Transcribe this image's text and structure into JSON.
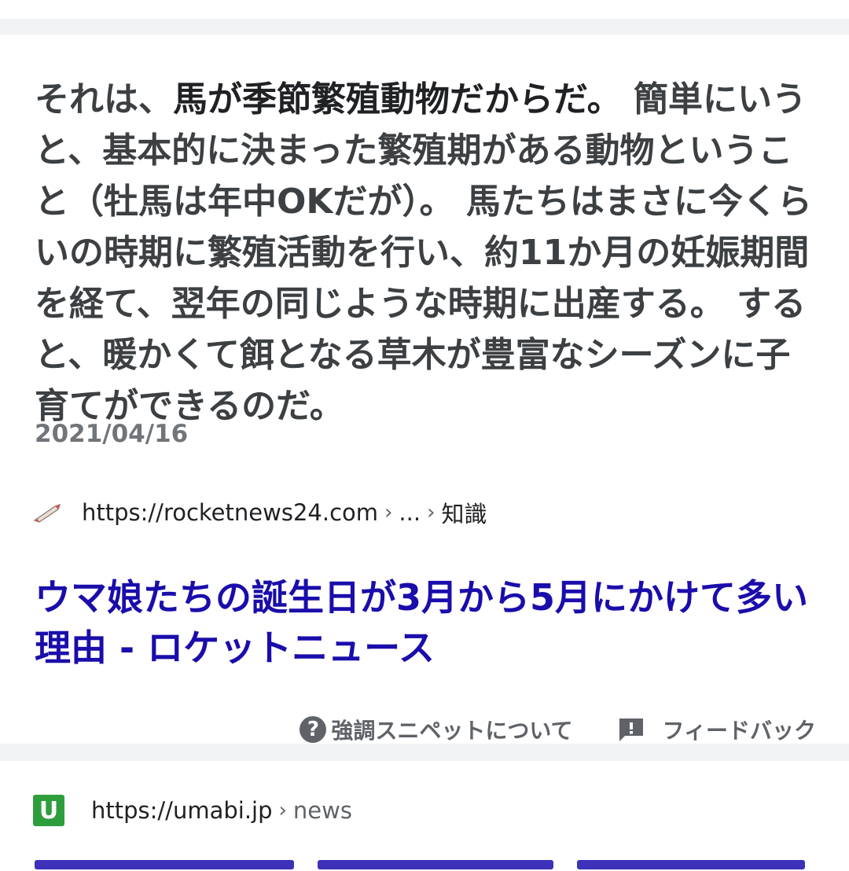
{
  "featured_snippet": {
    "text_intro": "それは、",
    "text_emphasis": "馬が季節繁殖動物だからだ。",
    "text_body": " 簡単にいうと、基本的に決まった繁殖期がある動物ということ（牡馬は年中OKだが）。 馬たちはまさに今くらいの時期に繁殖活動を行い、約11か月の妊娠期間を経て、翌年の同じような時期に出産する。 すると、暖かくて餌となる草木が豊富なシーズンに子育てができるのだ。",
    "date": "2021/04/16",
    "source": {
      "favicon": "rocket-icon",
      "url": "https://rocketnews24.com",
      "crumb_ellipsis": "...",
      "crumb_last": "知識",
      "separator": "›"
    },
    "title": "ウマ娘たちの誕生日が3月から5月にかけて多い理由 - ロケットニュース",
    "actions": {
      "about_label": "強調スニペットについて",
      "feedback_label": "フィードバック"
    }
  },
  "next_result": {
    "favicon_letter": "U",
    "url": "https://umabi.jp",
    "separator": "›",
    "crumb": "news"
  },
  "colors": {
    "link": "#1a0dab",
    "text": "#3c4043",
    "muted": "#70757a",
    "background": "#f1f3f4",
    "favicon_green": "#2e9e3d"
  }
}
